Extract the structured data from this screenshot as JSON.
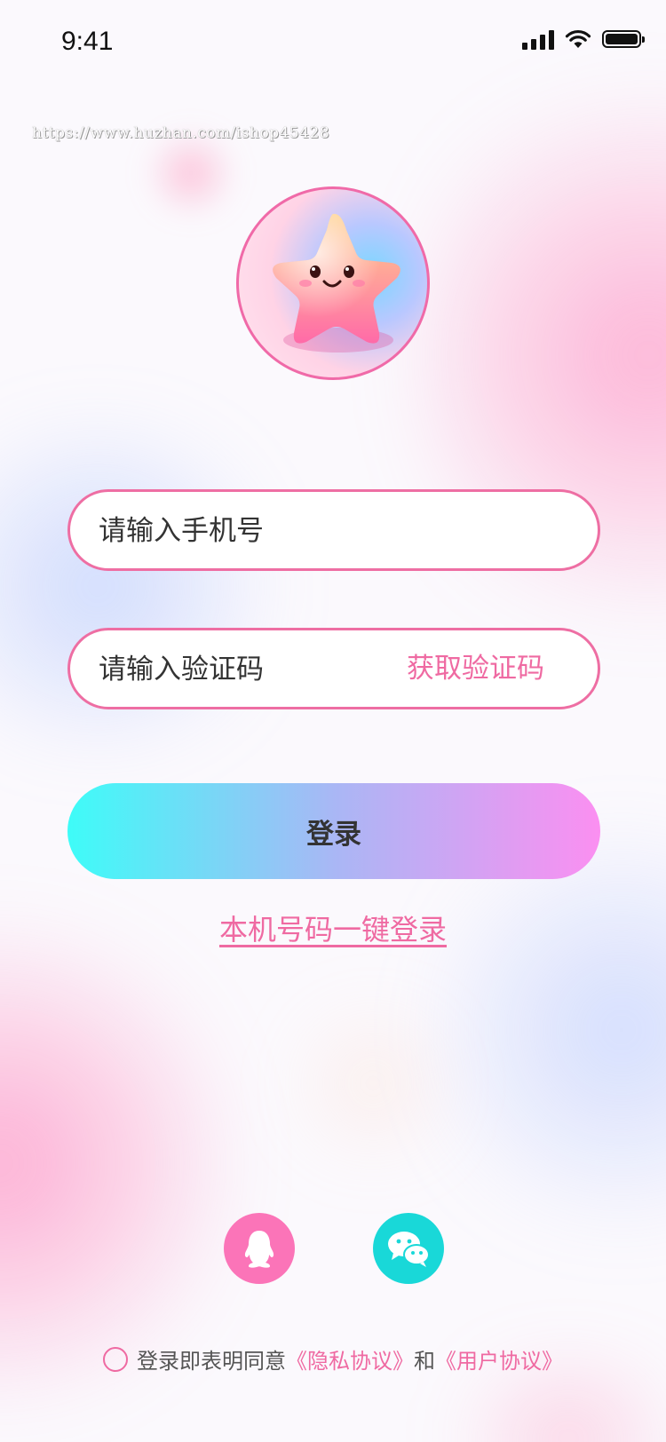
{
  "status_bar": {
    "time": "9:41"
  },
  "watermark": "https://www.huzhan.com/ishop45428",
  "login_form": {
    "phone_placeholder": "请输入手机号",
    "code_placeholder": "请输入验证码",
    "get_code_label": "获取验证码",
    "login_label": "登录",
    "onekey_label": "本机号码一键登录"
  },
  "social_logins": [
    {
      "name": "qq",
      "icon": "qq-icon",
      "color": "#fb74b8"
    },
    {
      "name": "wechat",
      "icon": "wechat-icon",
      "color": "#19d8d8"
    }
  ],
  "agreement": {
    "prefix": "登录即表明同意",
    "privacy_link": "《隐私协议》",
    "conjunction": "和",
    "user_link": "《用户协议》"
  },
  "colors": {
    "accent_pink": "#ef6aa2",
    "button_gradient_start": "#3efcf8",
    "button_gradient_end": "#fb8ff1",
    "qq_bg": "#fb74b8",
    "wechat_bg": "#19d8d8"
  }
}
